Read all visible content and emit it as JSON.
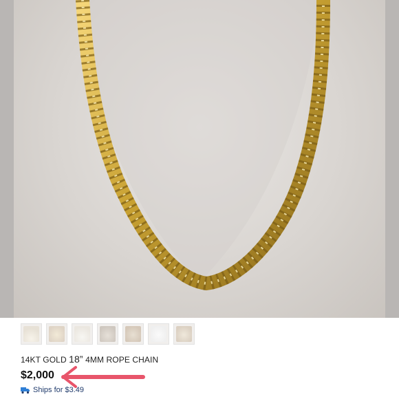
{
  "listing": {
    "title_prefix": "14KT GOLD",
    "title_number": "18”",
    "title_suffix": "4MM ROPE CHAIN",
    "price": "$2,000",
    "shipping": "Ships for $3.49"
  },
  "thumbnails": [
    "thumbnail-1",
    "thumbnail-2",
    "thumbnail-3",
    "thumbnail-4",
    "thumbnail-5",
    "thumbnail-6",
    "thumbnail-7"
  ],
  "colors": {
    "gold": "#c9a233",
    "arrow": "#e8556b",
    "shipping_text": "#1f3a6b"
  }
}
